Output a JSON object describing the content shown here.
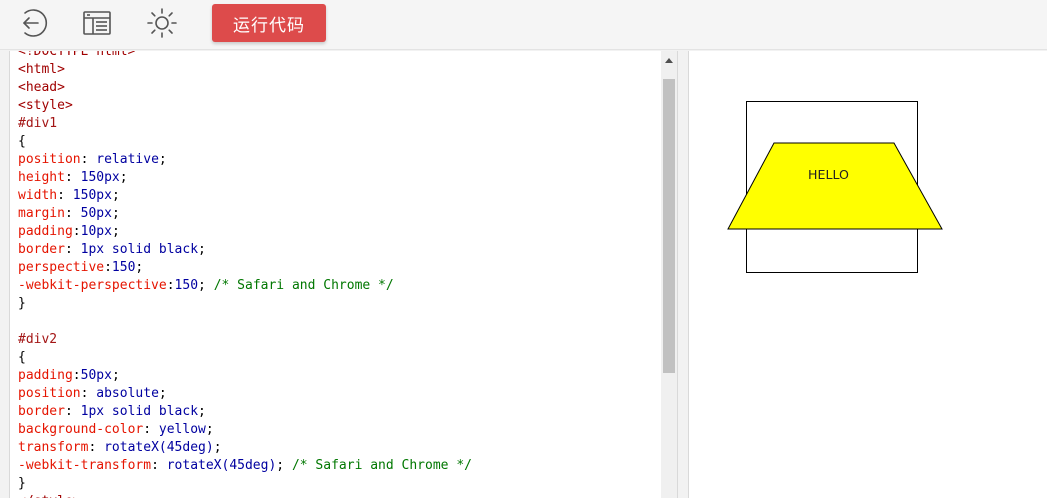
{
  "toolbar": {
    "run_label": "运行代码",
    "icons": [
      "back-icon",
      "layout-icon",
      "theme-sun-icon"
    ]
  },
  "editor": {
    "lines": [
      [
        {
          "t": "<!DOCTYPE html>",
          "c": "tag"
        }
      ],
      [
        {
          "t": "<html>",
          "c": "tag"
        }
      ],
      [
        {
          "t": "<head>",
          "c": "tag"
        }
      ],
      [
        {
          "t": "<style>",
          "c": "tag"
        }
      ],
      [
        {
          "t": "#div1",
          "c": "sel"
        }
      ],
      [
        {
          "t": "{",
          "c": "pun"
        }
      ],
      [
        {
          "t": "position",
          "c": "prop"
        },
        {
          "t": ": ",
          "c": "pun"
        },
        {
          "t": "relative",
          "c": "val"
        },
        {
          "t": ";",
          "c": "pun"
        }
      ],
      [
        {
          "t": "height",
          "c": "prop"
        },
        {
          "t": ": ",
          "c": "pun"
        },
        {
          "t": "150px",
          "c": "val"
        },
        {
          "t": ";",
          "c": "pun"
        }
      ],
      [
        {
          "t": "width",
          "c": "prop"
        },
        {
          "t": ": ",
          "c": "pun"
        },
        {
          "t": "150px",
          "c": "val"
        },
        {
          "t": ";",
          "c": "pun"
        }
      ],
      [
        {
          "t": "margin",
          "c": "prop"
        },
        {
          "t": ": ",
          "c": "pun"
        },
        {
          "t": "50px",
          "c": "val"
        },
        {
          "t": ";",
          "c": "pun"
        }
      ],
      [
        {
          "t": "padding",
          "c": "prop"
        },
        {
          "t": ":",
          "c": "pun"
        },
        {
          "t": "10px",
          "c": "val"
        },
        {
          "t": ";",
          "c": "pun"
        }
      ],
      [
        {
          "t": "border",
          "c": "prop"
        },
        {
          "t": ": ",
          "c": "pun"
        },
        {
          "t": "1px solid black",
          "c": "val"
        },
        {
          "t": ";",
          "c": "pun"
        }
      ],
      [
        {
          "t": "perspective",
          "c": "prop"
        },
        {
          "t": ":",
          "c": "pun"
        },
        {
          "t": "150",
          "c": "val"
        },
        {
          "t": ";",
          "c": "pun"
        }
      ],
      [
        {
          "t": "-webkit-perspective",
          "c": "prop"
        },
        {
          "t": ":",
          "c": "pun"
        },
        {
          "t": "150",
          "c": "val"
        },
        {
          "t": "; ",
          "c": "pun"
        },
        {
          "t": "/* Safari and Chrome */",
          "c": "cmt"
        }
      ],
      [
        {
          "t": "}",
          "c": "pun"
        }
      ],
      [],
      [
        {
          "t": "#div2",
          "c": "sel"
        }
      ],
      [
        {
          "t": "{",
          "c": "pun"
        }
      ],
      [
        {
          "t": "padding",
          "c": "prop"
        },
        {
          "t": ":",
          "c": "pun"
        },
        {
          "t": "50px",
          "c": "val"
        },
        {
          "t": ";",
          "c": "pun"
        }
      ],
      [
        {
          "t": "position",
          "c": "prop"
        },
        {
          "t": ": ",
          "c": "pun"
        },
        {
          "t": "absolute",
          "c": "val"
        },
        {
          "t": ";",
          "c": "pun"
        }
      ],
      [
        {
          "t": "border",
          "c": "prop"
        },
        {
          "t": ": ",
          "c": "pun"
        },
        {
          "t": "1px solid black",
          "c": "val"
        },
        {
          "t": ";",
          "c": "pun"
        }
      ],
      [
        {
          "t": "background-color",
          "c": "prop"
        },
        {
          "t": ": ",
          "c": "pun"
        },
        {
          "t": "yellow",
          "c": "val"
        },
        {
          "t": ";",
          "c": "pun"
        }
      ],
      [
        {
          "t": "transform",
          "c": "prop"
        },
        {
          "t": ": ",
          "c": "pun"
        },
        {
          "t": "rotateX(45deg)",
          "c": "val"
        },
        {
          "t": ";",
          "c": "pun"
        }
      ],
      [
        {
          "t": "-webkit-transform",
          "c": "prop"
        },
        {
          "t": ": ",
          "c": "pun"
        },
        {
          "t": "rotateX(45deg)",
          "c": "val"
        },
        {
          "t": "; ",
          "c": "pun"
        },
        {
          "t": "/* Safari and Chrome */",
          "c": "cmt"
        }
      ],
      [
        {
          "t": "}",
          "c": "pun"
        }
      ],
      [
        {
          "t": "</style>",
          "c": "tag"
        }
      ]
    ]
  },
  "preview": {
    "text": "HELLO",
    "fill_color": "#ffff00"
  }
}
